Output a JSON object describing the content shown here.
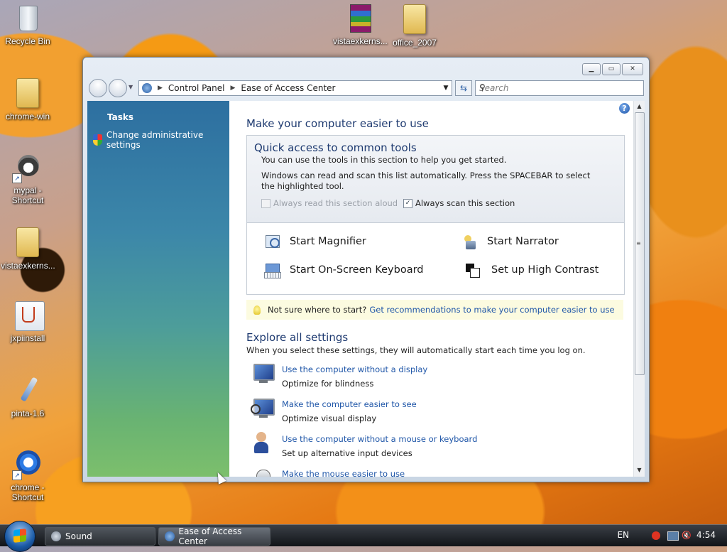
{
  "desktop": {
    "icons": [
      {
        "label": "Recycle Bin",
        "icon": "recycle-bin-icon"
      },
      {
        "label": "vistaexkerns...",
        "icon": "winrar-archive-icon"
      },
      {
        "label": "office_2007",
        "icon": "folder-icon"
      },
      {
        "label": "chrome-win",
        "icon": "folder-icon"
      },
      {
        "label": "mypal - Shortcut",
        "icon": "raccoon-icon"
      },
      {
        "label": "vistaexkerns...",
        "icon": "folder-icon"
      },
      {
        "label": "jxpiinstall",
        "icon": "java-installer-icon"
      },
      {
        "label": "pinta-1.6",
        "icon": "paintbrush-icon"
      },
      {
        "label": "chrome - Shortcut",
        "icon": "chrome-icon"
      }
    ]
  },
  "window": {
    "title_buttons": {
      "minimize": "▁",
      "maximize": "▭",
      "close": "✕"
    },
    "breadcrumb": [
      "Control Panel",
      "Ease of Access Center"
    ],
    "search_placeholder": "Search",
    "sidebar": {
      "heading": "Tasks",
      "links": [
        "Change administrative settings"
      ]
    },
    "help_label": "?",
    "main": {
      "title": "Make your computer easier to use",
      "quick_access": {
        "title": "Quick access to common tools",
        "line1": "You can use the tools in this section to help you get started.",
        "line2": "Windows can read and scan this list automatically.  Press the SPACEBAR to select the highlighted tool.",
        "checkbox_read": {
          "label": "Always read this section aloud",
          "checked": false,
          "enabled": false
        },
        "checkbox_scan": {
          "label": "Always scan this section",
          "checked": true,
          "enabled": true
        },
        "tools": [
          {
            "label": "Start Magnifier",
            "icon": "magnifier-icon"
          },
          {
            "label": "Start Narrator",
            "icon": "narrator-icon"
          },
          {
            "label": "Start On-Screen Keyboard",
            "icon": "keyboard-icon"
          },
          {
            "label": "Set up High Contrast",
            "icon": "high-contrast-icon"
          }
        ]
      },
      "tip": {
        "text": "Not sure where to start?",
        "link": "Get recommendations to make your computer easier to use"
      },
      "explore": {
        "title": "Explore all settings",
        "subtitle": "When you select these settings, they will automatically start each time you log on.",
        "items": [
          {
            "link": "Use the computer without a display",
            "desc": "Optimize for blindness",
            "icon": "monitor-icon"
          },
          {
            "link": "Make the computer easier to see",
            "desc": "Optimize visual display",
            "icon": "monitor-magnifier-icon"
          },
          {
            "link": "Use the computer without a mouse or keyboard",
            "desc": "Set up alternative input devices",
            "icon": "person-icon"
          },
          {
            "link": "Make the mouse easier to use",
            "desc": "",
            "icon": "mouse-icon"
          }
        ]
      }
    }
  },
  "taskbar": {
    "buttons": [
      "Sound",
      "Ease of Access Center"
    ],
    "language": "EN",
    "clock": "4:54"
  },
  "colors": {
    "link": "#1f56a8",
    "heading": "#1e3a70",
    "tip_bg": "#fcfbe0"
  }
}
